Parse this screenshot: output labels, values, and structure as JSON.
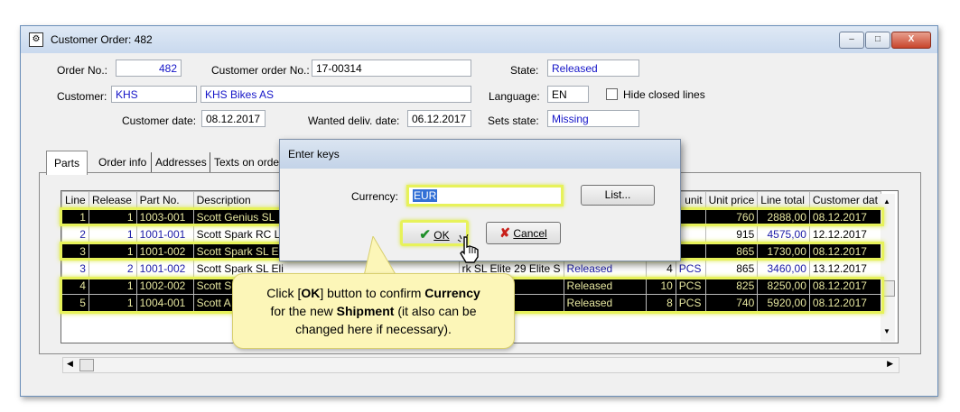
{
  "window": {
    "title": "Customer Order: 482",
    "min_label": "–",
    "max_label": "□",
    "close_label": "X"
  },
  "header": {
    "order_no_label": "Order No.:",
    "order_no": "482",
    "customer_order_no_label": "Customer order No.:",
    "customer_order_no": "17-00314",
    "state_label": "State:",
    "state": "Released",
    "customer_label": "Customer:",
    "customer_code": "KHS",
    "customer_name": "KHS Bikes AS",
    "language_label": "Language:",
    "language": "EN",
    "hide_closed_label": "Hide closed lines",
    "customer_date_label": "Customer date:",
    "customer_date": "08.12.2017",
    "wanted_date_label": "Wanted deliv. date:",
    "wanted_date": "06.12.2017",
    "sets_state_label": "Sets state:",
    "sets_state": "Missing"
  },
  "tabs": [
    "Parts",
    "Order info",
    "Addresses",
    "Texts on orde"
  ],
  "grid": {
    "columns_left": [
      "Line",
      "Release",
      "Part No.",
      "Description"
    ],
    "columns_right": [
      "unit",
      "Unit price",
      "Line total",
      "Customer dat"
    ],
    "rows": [
      {
        "line": "1",
        "release": "1",
        "part": "1003-001",
        "desc": "Scott Genius SL",
        "price": "760",
        "total": "2888,00",
        "date": "08.12.2017",
        "dark": true
      },
      {
        "line": "2",
        "release": "1",
        "part": "1001-001",
        "desc": "Scott Spark RC L",
        "price": "915",
        "total": "4575,00",
        "date": "12.12.2017",
        "dark": false
      },
      {
        "line": "3",
        "release": "1",
        "part": "1001-002",
        "desc": "Scott Spark SL E",
        "price": "865",
        "total": "1730,00",
        "date": "08.12.2017",
        "dark": true
      },
      {
        "line": "3",
        "release": "2",
        "part": "1001-002",
        "desc": "Scott Spark SL Eli",
        "mid": "rk SL Elite 29  Elite S",
        "state": "Released",
        "qty": "4",
        "unit": "PCS",
        "price": "865",
        "total": "3460,00",
        "date": "13.12.2017",
        "dark": false
      },
      {
        "line": "4",
        "release": "1",
        "part": "1002-002",
        "desc": "Scott S",
        "state": "Released",
        "qty": "10",
        "unit": "PCS",
        "price": "825",
        "total": "8250,00",
        "date": "08.12.2017",
        "dark": true
      },
      {
        "line": "5",
        "release": "1",
        "part": "1004-001",
        "desc": "Scott A",
        "state": "Released",
        "qty": "8",
        "unit": "PCS",
        "price": "740",
        "total": "5920,00",
        "date": "08.12.2017",
        "dark": true
      }
    ]
  },
  "dialog": {
    "title": "Enter keys",
    "currency_label": "Currency:",
    "currency_value": "EUR",
    "list_label": "List...",
    "ok_label": "OK",
    "cancel_label": "Cancel"
  },
  "callout": {
    "t1": "Click [",
    "t2": "OK",
    "t3": "] button to confirm ",
    "t4": "Currency",
    "t5": "for the new ",
    "t6": "Shipment",
    "t7": " (it also can be",
    "t8": "changed here if necessary)."
  },
  "colors": {
    "highlight": "#e7f25a",
    "blue_text": "#1515c8",
    "callout_bg": "#fcf6b8"
  }
}
